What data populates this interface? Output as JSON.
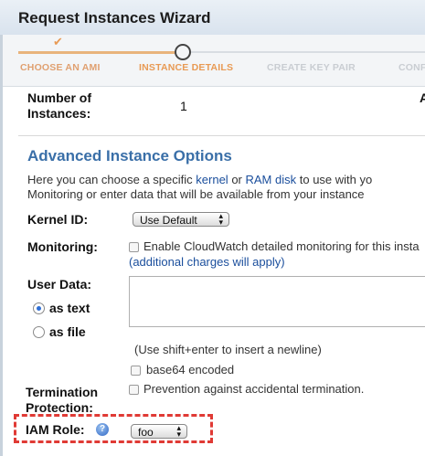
{
  "window": {
    "title": "Request Instances Wizard"
  },
  "wizard": {
    "steps": [
      {
        "label": "CHOOSE AN AMI",
        "state": "done"
      },
      {
        "label": "INSTANCE DETAILS",
        "state": "current"
      },
      {
        "label": "CREATE KEY PAIR",
        "state": "todo"
      },
      {
        "label": "CONFI",
        "state": "todo"
      }
    ],
    "check_glyph": "✔"
  },
  "instances": {
    "label_line1": "Number of",
    "label_line2": "Instances:",
    "value": "1",
    "right_clipped": "A"
  },
  "advanced": {
    "title": "Advanced Instance Options",
    "desc_line1_a": "Here you can choose a specific ",
    "desc_link_kernel": "kernel",
    "desc_or": " or ",
    "desc_link_ramdisk": "RAM disk",
    "desc_line1_b": " to use with yo",
    "desc_line2": "Monitoring or enter data that will be available from your instance"
  },
  "kernel": {
    "label": "Kernel ID:",
    "selected": "Use Default"
  },
  "monitoring": {
    "label": "Monitoring:",
    "checkbox_label": "Enable CloudWatch detailed monitoring for this insta",
    "charges_link": "(additional charges will apply)",
    "checked": false
  },
  "user_data": {
    "label": "User Data:",
    "as_text": "as text",
    "as_file": "as file",
    "selected": "as text",
    "hint": "(Use shift+enter to insert a newline)",
    "base64_label": "base64 encoded",
    "base64_checked": false
  },
  "termination": {
    "label_line1": "Termination",
    "label_line2": "Protection:",
    "checkbox_label": "Prevention against accidental termination.",
    "checked": false
  },
  "iam": {
    "label": "IAM Role:",
    "help_glyph": "?",
    "selected": "foo"
  },
  "colors": {
    "accent": "#3a6fa8",
    "step_current": "#e89a54",
    "highlight": "#e03a35",
    "link": "#1a4e9c"
  }
}
